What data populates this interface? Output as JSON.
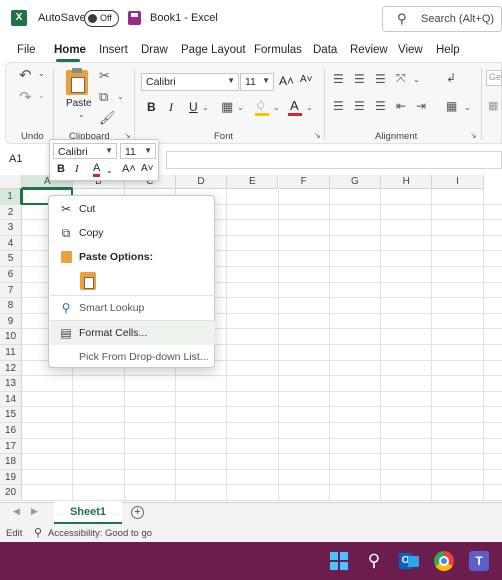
{
  "titlebar": {
    "app_logo": "X",
    "autosave_label": "AutoSave",
    "autosave_state": "Off",
    "doc_title": "Book1  -  Excel",
    "search_placeholder": "Search (Alt+Q)"
  },
  "menu": {
    "tabs": [
      "File",
      "Home",
      "Insert",
      "Draw",
      "Page Layout",
      "Formulas",
      "Data",
      "Review",
      "View",
      "Help"
    ]
  },
  "ribbon": {
    "undo_label": "Undo",
    "clipboard_label": "Clipboard",
    "paste_label": "Paste",
    "font_label": "Font",
    "alignment_label": "Alignment",
    "font_name": "Calibri",
    "font_size": "11",
    "bold": "B",
    "italic": "I",
    "underline": "U",
    "grow_font": "A˄",
    "shrink_font": "A˅",
    "font_color_letter": "A",
    "next_group_partial": "Gen"
  },
  "formula_bar": {
    "name_box": "A1"
  },
  "mini_toolbar": {
    "font_name": "Calibri",
    "font_size": "11",
    "bold": "B",
    "italic": "I",
    "font_color_letter": "A",
    "grow_font": "A˄",
    "shrink_font": "A˅"
  },
  "grid": {
    "columns": [
      "A",
      "B",
      "C",
      "D",
      "E",
      "F",
      "G",
      "H",
      "I"
    ],
    "rows": [
      "1",
      "2",
      "3",
      "4",
      "5",
      "6",
      "7",
      "8",
      "9",
      "10",
      "11",
      "12",
      "13",
      "14",
      "15",
      "16",
      "17",
      "18",
      "19",
      "20"
    ],
    "active_cell": "A1"
  },
  "context_menu": {
    "items": [
      {
        "icon": "scissors-icon",
        "label": "Cut"
      },
      {
        "icon": "copy-icon",
        "label": "Copy"
      },
      {
        "icon": "paste-icon",
        "label": "Paste Options:"
      },
      {
        "icon": "smart-lookup-icon",
        "label": "Smart Lookup"
      },
      {
        "icon": "format-cells-icon",
        "label": "Format Cells..."
      },
      {
        "icon": "",
        "label": "Pick From Drop-down List..."
      }
    ]
  },
  "sheets": {
    "active": "Sheet1",
    "add_label": "+"
  },
  "statusbar": {
    "mode": "Edit",
    "accessibility": "Accessibility: Good to go"
  },
  "colors": {
    "accent": "#1f7346",
    "taskbar": "#6b1d4d",
    "hover": "#eef3ee"
  }
}
